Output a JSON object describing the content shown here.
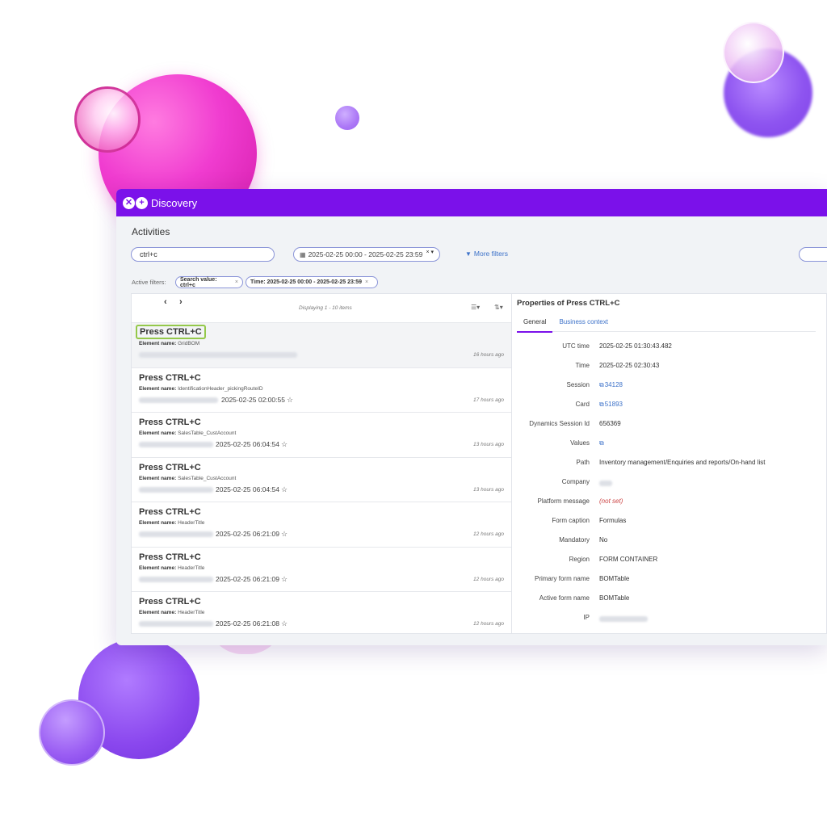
{
  "app": {
    "brand": "Discovery",
    "logo_glyphs": [
      "✕",
      "+"
    ],
    "accent_color": "#7b11ea"
  },
  "page": {
    "title": "Activities"
  },
  "filters": {
    "search_value": "ctrl+c",
    "date_range": "2025-02-25 00:00 - 2025-02-25 23:59",
    "date_controls": "× ▾",
    "more_filters_label": "More filters",
    "active_label": "Active filters:",
    "chips": [
      {
        "label": "Search value: ctrl+c",
        "remove": "×"
      },
      {
        "label": "Time: 2025-02-25 00:00 - 2025-02-25 23:59",
        "remove": "×"
      }
    ]
  },
  "list": {
    "prev": "‹",
    "next": "›",
    "displaying": "Displaying 1 - 10 items",
    "element_name_label": "Element name:",
    "items": [
      {
        "title": "Press CTRL+C",
        "element": "GridBOM",
        "datetime": "",
        "ago": "16 hours ago"
      },
      {
        "title": "Press CTRL+C",
        "element": "IdentificationHeader_pickingRouteID",
        "datetime": "2025-02-25 02:00:55",
        "ago": "17 hours ago"
      },
      {
        "title": "Press CTRL+C",
        "element": "SalesTable_CustAccount",
        "datetime": "2025-02-25 06:04:54",
        "ago": "13 hours ago"
      },
      {
        "title": "Press CTRL+C",
        "element": "SalesTable_CustAccount",
        "datetime": "2025-02-25 06:04:54",
        "ago": "13 hours ago"
      },
      {
        "title": "Press CTRL+C",
        "element": "HeaderTitle",
        "datetime": "2025-02-25 06:21:09",
        "ago": "12 hours ago"
      },
      {
        "title": "Press CTRL+C",
        "element": "HeaderTitle",
        "datetime": "2025-02-25 06:21:09",
        "ago": "12 hours ago"
      },
      {
        "title": "Press CTRL+C",
        "element": "HeaderTitle",
        "datetime": "2025-02-25 06:21:08",
        "ago": "12 hours ago"
      }
    ]
  },
  "properties": {
    "title": "Properties of Press CTRL+C",
    "tabs": [
      "General",
      "Business context"
    ],
    "rows": [
      {
        "key": "UTC time",
        "value": "2025-02-25 01:30:43.482"
      },
      {
        "key": "Time",
        "value": "2025-02-25 02:30:43"
      },
      {
        "key": "Session",
        "value": "34128"
      },
      {
        "key": "Card",
        "value": "51893"
      },
      {
        "key": "Dynamics Session Id",
        "value": "656369"
      },
      {
        "key": "Values",
        "value": ""
      },
      {
        "key": "Path",
        "value": "Inventory management/Enquiries and reports/On-hand list"
      },
      {
        "key": "Company",
        "value": ""
      },
      {
        "key": "Platform message",
        "value": "(not set)"
      },
      {
        "key": "Form caption",
        "value": "Formulas"
      },
      {
        "key": "Mandatory",
        "value": "No"
      },
      {
        "key": "Region",
        "value": "FORM CONTAINER"
      },
      {
        "key": "Primary form name",
        "value": "BOMTable"
      },
      {
        "key": "Active form name",
        "value": "BOMTable"
      },
      {
        "key": "IP",
        "value": ""
      }
    ]
  }
}
